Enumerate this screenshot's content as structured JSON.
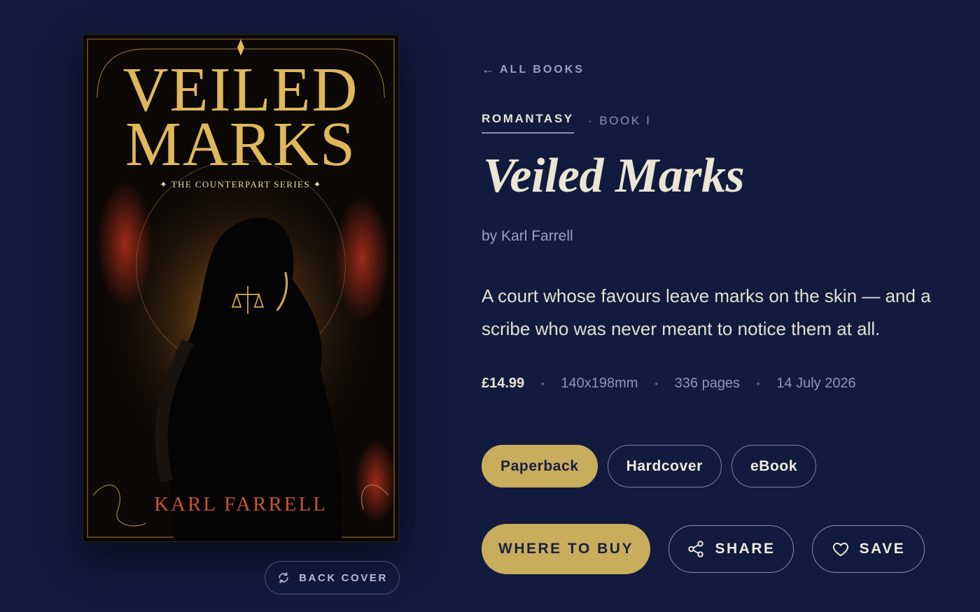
{
  "nav": {
    "back_arrow": "←",
    "back_label": "ALL BOOKS"
  },
  "cover": {
    "title_line1": "VEILED",
    "title_line2": "MARKS",
    "series": "✦ THE COUNTERPART SERIES ✦",
    "author": "KARL FARRELL",
    "back_cover_label": "BACK COVER",
    "back_cover_icon": "rotate-icon"
  },
  "book": {
    "genre": "ROMANTASY",
    "book_number": "BOOK I",
    "book_number_dot": "·",
    "title": "Veiled Marks",
    "author": "by Karl Farrell",
    "blurb": "A court whose favours leave marks on the skin — and a scribe who was never meant to notice them at all.",
    "price": "£14.99",
    "dimensions": "140x198mm",
    "pages": "336 pages",
    "release_date": "14 July 2026",
    "meta_separator": "•"
  },
  "formats": [
    {
      "label": "Paperback",
      "selected": true
    },
    {
      "label": "Hardcover",
      "selected": false
    },
    {
      "label": "eBook",
      "selected": false
    }
  ],
  "actions": {
    "buy_label": "WHERE TO BUY",
    "share_label": "SHARE",
    "share_icon": "share-icon",
    "save_label": "SAVE",
    "save_icon": "heart-icon"
  },
  "colors": {
    "background": "#121a3d",
    "accent_gold": "#c8ad5d",
    "text_light": "#e9e4d6",
    "text_muted": "#9aa1bf"
  }
}
